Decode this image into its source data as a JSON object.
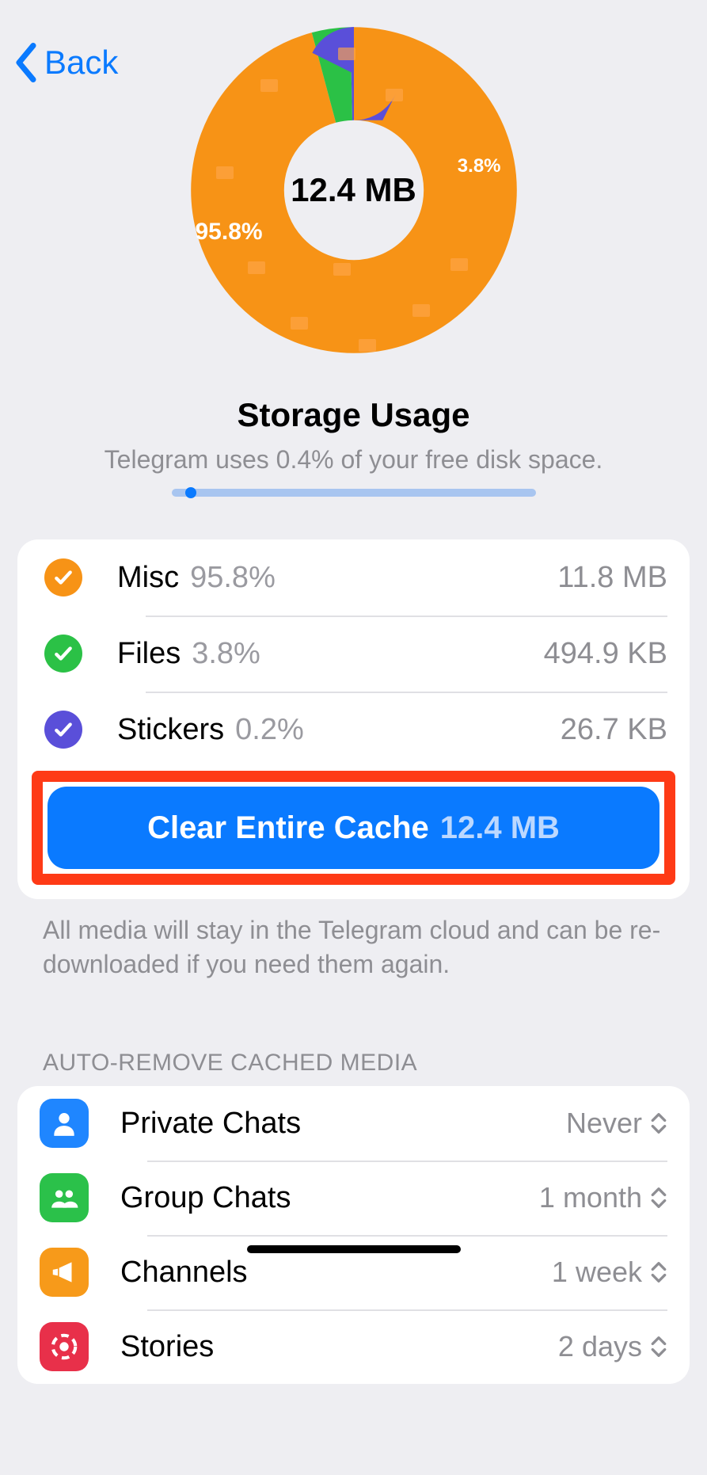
{
  "nav": {
    "back_label": "Back"
  },
  "chart_data": {
    "type": "pie",
    "title": "Storage Usage",
    "center_label": "12.4 MB",
    "series": [
      {
        "name": "Misc",
        "value": 95.8,
        "label": "95.8%",
        "color": "#f79316"
      },
      {
        "name": "Files",
        "value": 3.8,
        "label": "3.8%",
        "color": "#2bc146"
      },
      {
        "name": "Stickers",
        "value": 0.4,
        "label": "",
        "color": "#5a4fd9"
      }
    ]
  },
  "heading": {
    "title": "Storage Usage",
    "subtitle": "Telegram uses 0.4% of your free disk space."
  },
  "categories": [
    {
      "check_color": "#f79316",
      "name": "Misc",
      "pct": "95.8%",
      "size": "11.8 MB"
    },
    {
      "check_color": "#2bc146",
      "name": "Files",
      "pct": "3.8%",
      "size": "494.9 KB"
    },
    {
      "check_color": "#5a4fd9",
      "name": "Stickers",
      "pct": "0.2%",
      "size": "26.7 KB"
    }
  ],
  "clear_button": {
    "label": "Clear Entire Cache",
    "size": "12.4 MB"
  },
  "footnote": "All media will stay in the Telegram cloud and can be re-downloaded if you need them again.",
  "auto_remove": {
    "header": "AUTO-REMOVE CACHED MEDIA",
    "items": [
      {
        "icon": "person",
        "color": "#1f86ff",
        "name": "Private Chats",
        "value": "Never"
      },
      {
        "icon": "group",
        "color": "#2bc14a",
        "name": "Group Chats",
        "value": "1 month"
      },
      {
        "icon": "megaphone",
        "color": "#f79a1a",
        "name": "Channels",
        "value": "1 week"
      },
      {
        "icon": "stories",
        "color": "#e8304a",
        "name": "Stories",
        "value": "2 days"
      }
    ]
  }
}
